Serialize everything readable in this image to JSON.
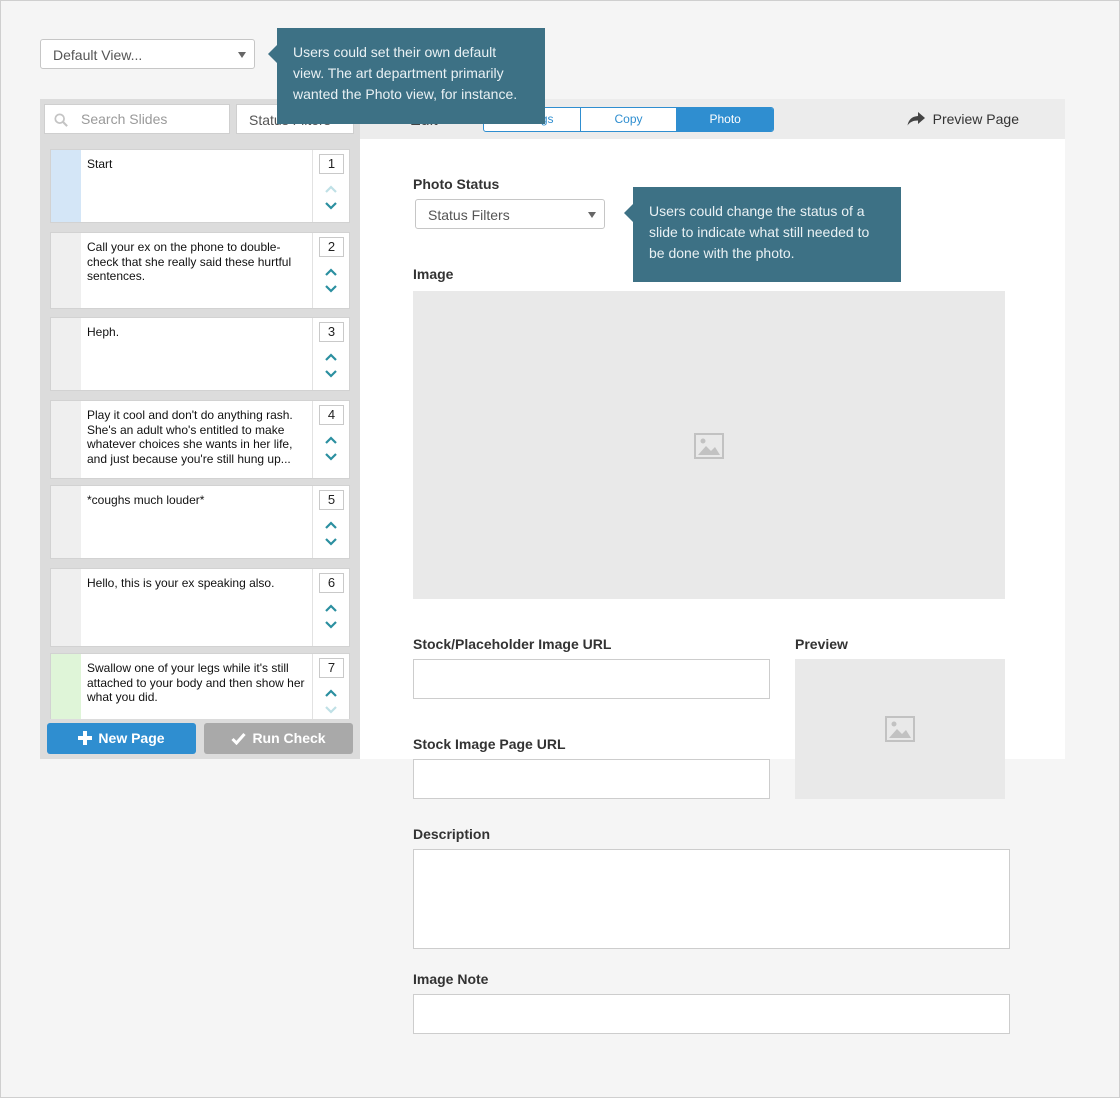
{
  "default_view": {
    "label": "Default View..."
  },
  "tooltips": {
    "default_view": "Users could set their own default view. The art department primarily wanted the Photo view, for instance.",
    "photo_status": "Users could change the status of a slide to indicate what still needed to be done with the photo."
  },
  "sidebar": {
    "search_placeholder": "Search Slides",
    "status_filter_label": "Status Filters",
    "slides": [
      {
        "number": "1",
        "text": "Start",
        "color": "#d4e6f7"
      },
      {
        "number": "2",
        "text": "Call your ex on the phone to double-check that she really said these hurtful sentences.",
        "color": "#efefef"
      },
      {
        "number": "3",
        "text": "Heph.",
        "color": "#efefef"
      },
      {
        "number": "4",
        "text": "Play it cool and don't do anything rash. She's an adult who's entitled to make whatever choices she wants in her life, and just because you're still hung up...",
        "color": "#efefef"
      },
      {
        "number": "5",
        "text": "*coughs much louder*",
        "color": "#efefef"
      },
      {
        "number": "6",
        "text": "Hello, this is your ex speaking also.",
        "color": "#efefef"
      },
      {
        "number": "7",
        "text": "Swallow one of your legs while it's still attached to your body and then show her what you did.",
        "color": "#dff5d8"
      }
    ],
    "new_page_label": "New Page",
    "run_check_label": "Run Check"
  },
  "topbar": {
    "edit_label": "Edit",
    "tabs": [
      "Settings",
      "Copy",
      "Photo"
    ],
    "active_tab": "Photo",
    "preview_label": "Preview Page"
  },
  "form": {
    "photo_status_label": "Photo Status",
    "photo_status_value": "Status Filters",
    "image_label": "Image",
    "stock_url_label": "Stock/Placeholder Image URL",
    "preview_label": "Preview",
    "stock_page_label": "Stock Image Page URL",
    "description_label": "Description",
    "image_note_label": "Image Note"
  },
  "colors": {
    "accent": "#2f8ed0",
    "tooltip": "#3d7185",
    "disabled_button": "#a9a9a9",
    "arrow_teal": "#2b8fa0"
  },
  "icons": [
    "search-icon",
    "caret-down-icon",
    "chevron-up-icon",
    "chevron-down-icon",
    "plus-icon",
    "check-icon",
    "share-arrow-icon",
    "image-placeholder-icon"
  ]
}
